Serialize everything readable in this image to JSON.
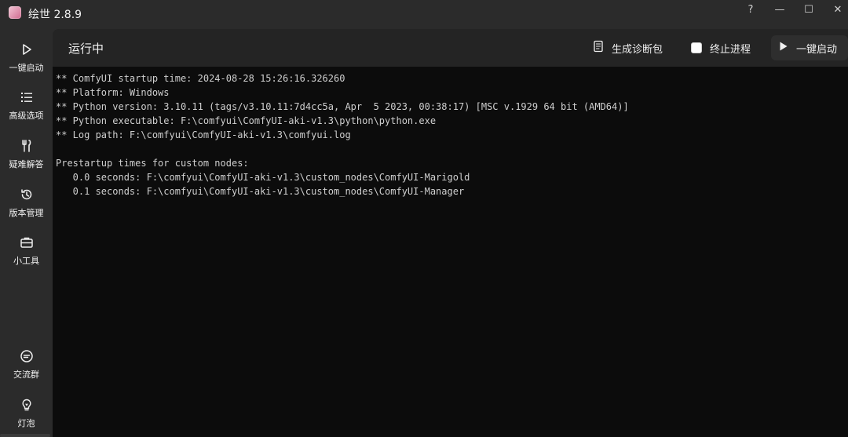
{
  "window": {
    "title": "绘世 2.8.9",
    "controls": {
      "help": "?",
      "minimize": "—",
      "maximize": "☐",
      "close": "✕"
    }
  },
  "sidebar": {
    "items": [
      {
        "label": "一键启动",
        "icon": "play-icon"
      },
      {
        "label": "高级选项",
        "icon": "list-icon"
      },
      {
        "label": "疑难解答",
        "icon": "tools-icon"
      },
      {
        "label": "版本管理",
        "icon": "history-icon"
      },
      {
        "label": "小工具",
        "icon": "toolbox-icon"
      },
      {
        "label": "交流群",
        "icon": "chat-icon"
      },
      {
        "label": "灯泡",
        "icon": "bulb-icon"
      }
    ]
  },
  "main": {
    "title": "运行中",
    "actions": {
      "diagnostics_label": "生成诊断包",
      "stop_label": "终止进程",
      "start_label": "一键启动"
    }
  },
  "console": {
    "lines": [
      "** ComfyUI startup time: 2024-08-28 15:26:16.326260",
      "** Platform: Windows",
      "** Python version: 3.10.11 (tags/v3.10.11:7d4cc5a, Apr  5 2023, 00:38:17) [MSC v.1929 64 bit (AMD64)]",
      "** Python executable: F:\\comfyui\\ComfyUI-aki-v1.3\\python\\python.exe",
      "** Log path: F:\\comfyui\\ComfyUI-aki-v1.3\\comfyui.log",
      "",
      "Prestartup times for custom nodes:",
      "   0.0 seconds: F:\\comfyui\\ComfyUI-aki-v1.3\\custom_nodes\\ComfyUI-Marigold",
      "   0.1 seconds: F:\\comfyui\\ComfyUI-aki-v1.3\\custom_nodes\\ComfyUI-Manager"
    ]
  },
  "colors": {
    "chrome_bg": "#2b2b2b",
    "panel_bg": "#202020",
    "console_bg": "#0c0c0c",
    "console_text": "#cfcfcf"
  }
}
